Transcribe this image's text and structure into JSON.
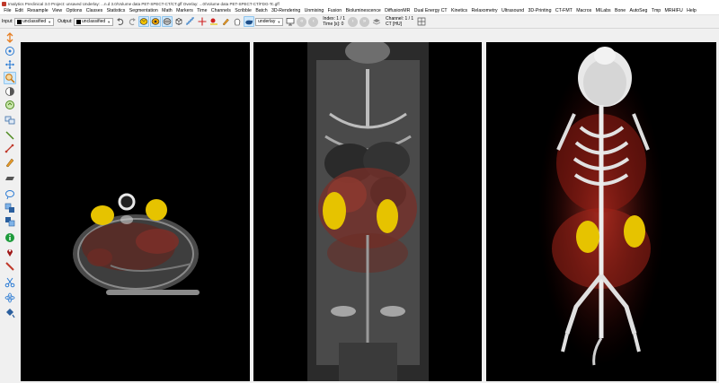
{
  "window": {
    "title": "Imalytics Preclinical 3.0 Project: unsaved   Underlay: ...n.d 3.0/Volume data PET-SPECT-CT/CT.gff   Overlay: ...0/Volume data PET-SPECT-CT/FDG-Tc.gff"
  },
  "menu": {
    "items": [
      "File",
      "Edit",
      "Resample",
      "View",
      "Options",
      "Classes",
      "Statistics",
      "Segmentation",
      "Math",
      "Markers",
      "Time",
      "Channels",
      "Scribble",
      "Batch",
      "3D-Rendering",
      "Unmixing",
      "Fusion",
      "Bioluminescence",
      "DiffusionMR",
      "Dual Energy CT",
      "Kinetics",
      "Relaxometry",
      "Ultrasound",
      "3D-Printing",
      "CT-FMT",
      "Macros",
      "MILabs",
      "Bone",
      "AutoSeg",
      "Tmp",
      "MRHIFU",
      "Help"
    ]
  },
  "toolbar": {
    "input_label": "Input:",
    "input_value": "unclassified",
    "output_label": "Output:",
    "output_value": "unclassified",
    "display_mode": "underlay",
    "index_label": "Index: 1 / 1",
    "time_label": "Time [s]: 0",
    "channel_label": "Channel: 1 / 1",
    "channel_name": "CT [HU]"
  },
  "colors": {
    "background": "#000000",
    "overlay_red": "#c0392b",
    "hotspot_yellow": "#e6c300",
    "highlight": "#cfe8fb"
  }
}
